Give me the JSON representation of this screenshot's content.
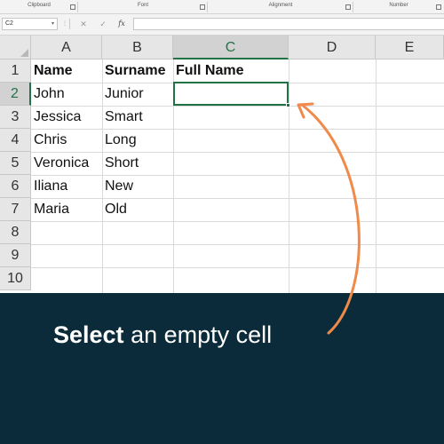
{
  "ribbon": {
    "groups": [
      {
        "label": "Clipboard"
      },
      {
        "label": "Font"
      },
      {
        "label": "Alignment"
      },
      {
        "label": "Number"
      }
    ]
  },
  "formula_bar": {
    "name_box": "C2",
    "cancel_icon": "✕",
    "enter_icon": "✓",
    "fx_label": "fx",
    "value": ""
  },
  "columns": [
    "A",
    "B",
    "C",
    "D",
    "E"
  ],
  "selected_column": "C",
  "rows": [
    "1",
    "2",
    "3",
    "4",
    "5",
    "6",
    "7",
    "8",
    "9",
    "10"
  ],
  "selected_row": "2",
  "headers": {
    "a": "Name",
    "b": "Surname",
    "c": "Full Name"
  },
  "people": [
    {
      "first": "John",
      "last": "Junior"
    },
    {
      "first": "Jessica",
      "last": "Smart"
    },
    {
      "first": "Chris",
      "last": "Long"
    },
    {
      "first": "Veronica",
      "last": "Short"
    },
    {
      "first": "Iliana",
      "last": "New"
    },
    {
      "first": "Maria",
      "last": "Old"
    }
  ],
  "caption": {
    "bold": "Select",
    "rest": " an empty cell"
  },
  "colors": {
    "accent": "#217346",
    "arrow": "#f08a4b",
    "banner": "#0c2b3a"
  }
}
